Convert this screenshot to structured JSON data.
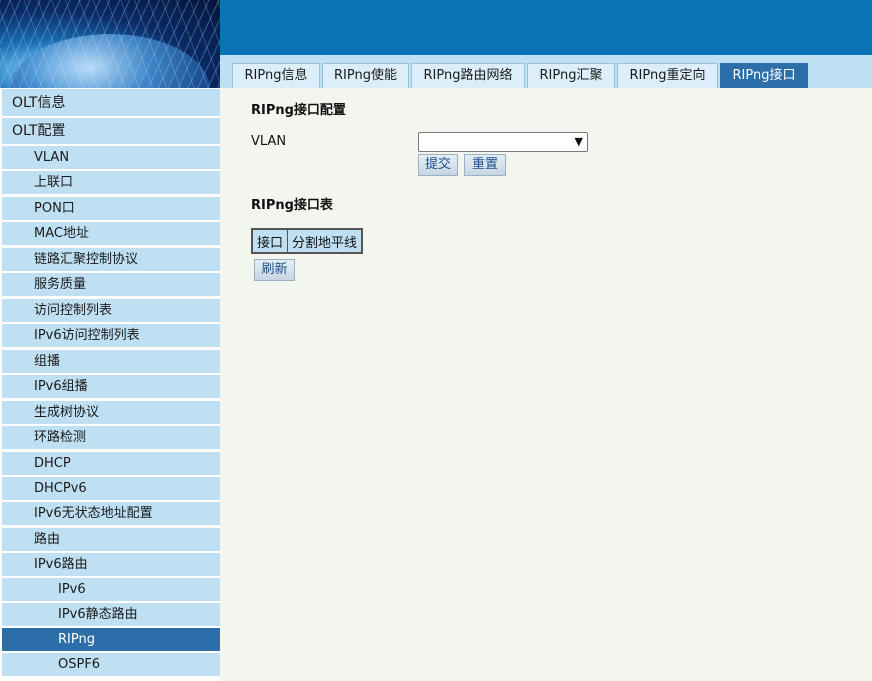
{
  "tabs": [
    {
      "label": "RIPng信息",
      "active": false
    },
    {
      "label": "RIPng使能",
      "active": false
    },
    {
      "label": "RIPng路由网络",
      "active": false
    },
    {
      "label": "RIPng汇聚",
      "active": false
    },
    {
      "label": "RIPng重定向",
      "active": false
    },
    {
      "label": "RIPng接口",
      "active": true
    }
  ],
  "sidebar": {
    "items": [
      {
        "label": "OLT信息",
        "level": 0
      },
      {
        "label": "OLT配置",
        "level": 0
      },
      {
        "label": "VLAN",
        "level": 1
      },
      {
        "label": "上联口",
        "level": 1
      },
      {
        "label": "PON口",
        "level": 1
      },
      {
        "label": "MAC地址",
        "level": 1
      },
      {
        "label": "链路汇聚控制协议",
        "level": 1
      },
      {
        "label": "服务质量",
        "level": 1
      },
      {
        "label": "访问控制列表",
        "level": 1
      },
      {
        "label": "IPv6访问控制列表",
        "level": 1
      },
      {
        "label": "组播",
        "level": 1
      },
      {
        "label": "IPv6组播",
        "level": 1
      },
      {
        "label": "生成树协议",
        "level": 1
      },
      {
        "label": "环路检测",
        "level": 1
      },
      {
        "label": "DHCP",
        "level": 1
      },
      {
        "label": "DHCPv6",
        "level": 1
      },
      {
        "label": "IPv6无状态地址配置",
        "level": 1
      },
      {
        "label": "路由",
        "level": 1
      },
      {
        "label": "IPv6路由",
        "level": 1
      },
      {
        "label": "IPv6",
        "level": 2
      },
      {
        "label": "IPv6静态路由",
        "level": 2
      },
      {
        "label": "RIPng",
        "level": 2,
        "active": true
      },
      {
        "label": "OSPF6",
        "level": 2
      }
    ]
  },
  "main": {
    "config_title": "RIPng接口配置",
    "vlan_label": "VLAN",
    "vlan_value": "",
    "submit_label": "提交",
    "reset_label": "重置",
    "table_title": "RIPng接口表",
    "table_headers": [
      "接口",
      "分割地平线"
    ],
    "refresh_label": "刷新"
  },
  "colors": {
    "header_bar": "#0a74b4",
    "tab_active": "#2c6ea8",
    "sidebar_bg": "#bfe0f3",
    "content_bg": "#f3f5ef"
  }
}
